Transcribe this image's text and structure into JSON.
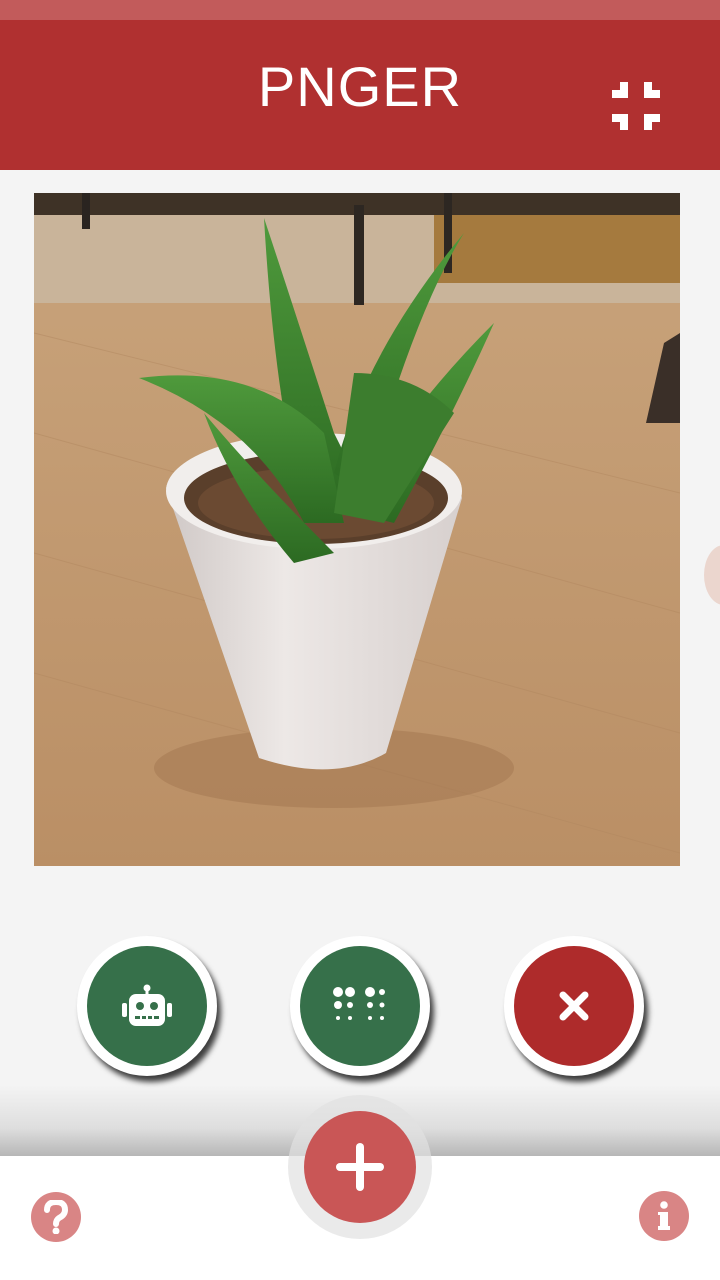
{
  "app": {
    "title": "PNGER"
  },
  "header": {
    "collapse_icon": "fullscreen-exit-icon"
  },
  "photo": {
    "subject_icon": "potted-aloe-photo"
  },
  "actions": [
    {
      "icon": "robot-icon",
      "color": "#36704a"
    },
    {
      "icon": "dots-grid-icon",
      "color": "#36704a"
    },
    {
      "icon": "close-icon",
      "color": "#ae2b2b"
    }
  ],
  "fab": {
    "icon": "plus-icon",
    "color": "#c95656"
  },
  "footer": {
    "help_icon": "question-icon",
    "info_icon": "info-icon"
  },
  "colors": {
    "app_bar": "#b03030",
    "status_bar": "#c25b5b",
    "background": "#f4f4f4",
    "muted_red": "#d98585"
  }
}
